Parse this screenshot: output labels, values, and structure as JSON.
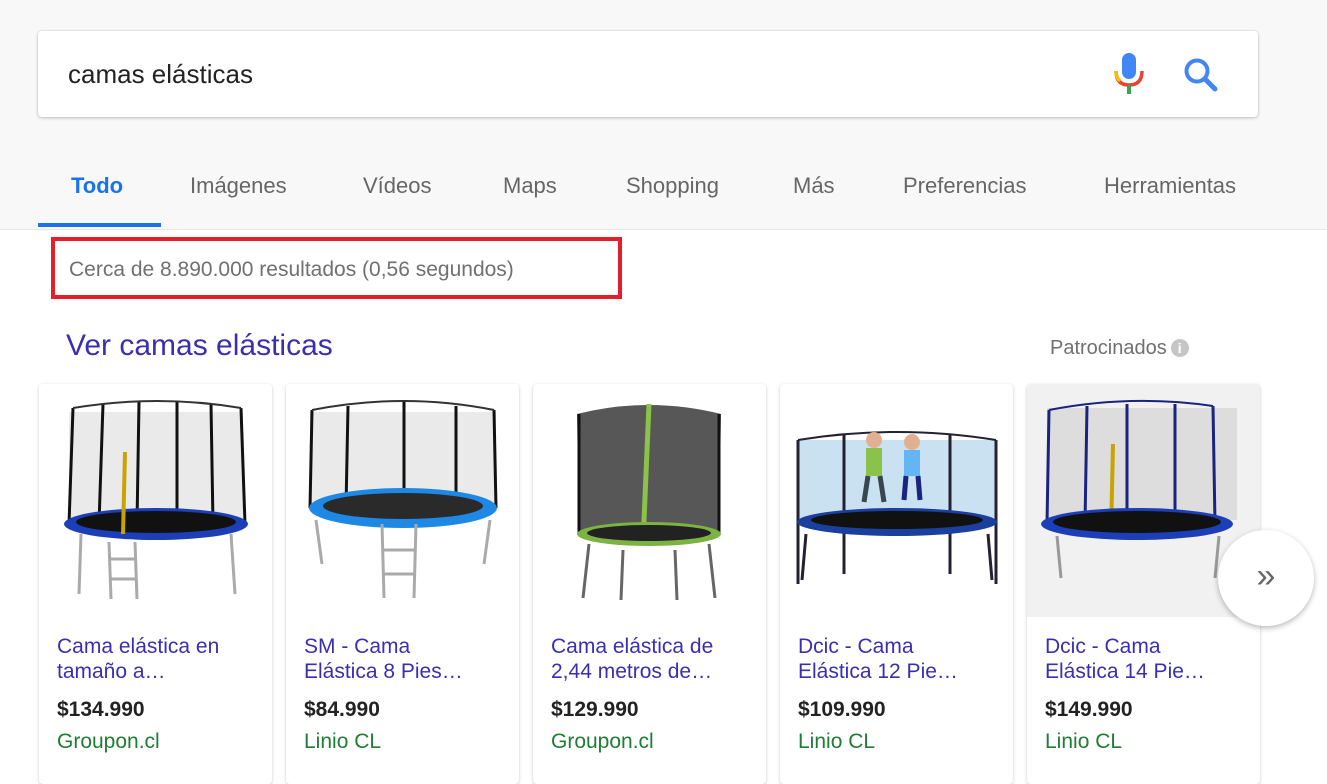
{
  "search": {
    "query": "camas elásticas"
  },
  "tabs": [
    {
      "label": "Todo",
      "active": true
    },
    {
      "label": "Imágenes"
    },
    {
      "label": "Vídeos"
    },
    {
      "label": "Maps"
    },
    {
      "label": "Shopping"
    },
    {
      "label": "Más"
    },
    {
      "label": "Preferencias"
    },
    {
      "label": "Herramientas"
    }
  ],
  "results_stats": "Cerca de 8.890.000 resultados (0,56 segundos)",
  "shopping": {
    "title": "Ver camas elásticas",
    "sponsored_label": "Patrocinados",
    "next_glyph": "»",
    "products": [
      {
        "title_line1": "Cama elástica en",
        "title_line2": "tamaño a…",
        "price": "$134.990",
        "merchant": "Groupon.cl"
      },
      {
        "title_line1": "SM - Cama",
        "title_line2": "Elástica 8 Pies…",
        "price": "$84.990",
        "merchant": "Linio CL"
      },
      {
        "title_line1": "Cama elástica de",
        "title_line2": "2,44 metros de…",
        "price": "$129.990",
        "merchant": "Groupon.cl"
      },
      {
        "title_line1": "Dcic - Cama",
        "title_line2": "Elástica 12 Pie…",
        "price": "$109.990",
        "merchant": "Linio CL"
      },
      {
        "title_line1": "Dcic - Cama",
        "title_line2": "Elástica 14 Pie…",
        "price": "$149.990",
        "merchant": "Linio CL"
      }
    ]
  },
  "colors": {
    "accent_blue": "#1a73e8",
    "link_purple": "#3a2fb0",
    "merchant_green": "#1e7e34",
    "highlight_red": "#e61e2a"
  }
}
